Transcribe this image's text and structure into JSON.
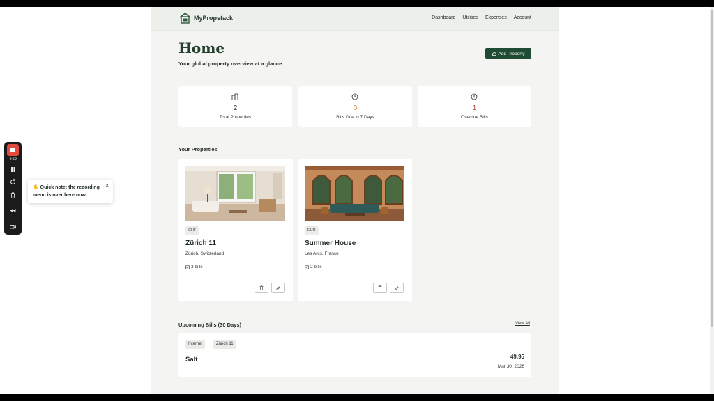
{
  "brand": {
    "name": "MyPropstack"
  },
  "nav": {
    "dashboard": "Dashboard",
    "utilities": "Utilities",
    "expenses": "Expenses",
    "account": "Account"
  },
  "header": {
    "title": "Home",
    "subtitle": "Your global property overview at a glance",
    "add_button": "Add Property"
  },
  "stats": [
    {
      "value": "2",
      "label": "Total Properties",
      "icon": "building-icon",
      "color": "#263028"
    },
    {
      "value": "0",
      "label": "Bills Due in 7 Days",
      "icon": "clock-icon",
      "color": "#c28a4e"
    },
    {
      "value": "1",
      "label": "Overdue Bills",
      "icon": "alert-circle-icon",
      "color": "#b0453a"
    }
  ],
  "properties_section": {
    "title": "Your Properties"
  },
  "properties": [
    {
      "currency": "CHF",
      "name": "Zürich 11",
      "location": "Zürich, Switzerland",
      "bills": "3 bills"
    },
    {
      "currency": "EUR",
      "name": "Summer House",
      "location": "Les Arcs, France",
      "bills": "2 bills"
    }
  ],
  "upcoming": {
    "title": "Upcoming Bills (30 Days)",
    "view_all": "View All",
    "bills": [
      {
        "category": "Internet",
        "property": "Zürich 11",
        "name": "Salt",
        "amount": "49.95",
        "date": "Mar 30, 2026"
      }
    ]
  },
  "recorder": {
    "time": "4:59"
  },
  "tooltip": {
    "text": "Quick note: the recording menu is over here now."
  },
  "colors": {
    "brand": "#1f4a33",
    "background": "#f4f5f2",
    "record": "#e34b3e"
  }
}
